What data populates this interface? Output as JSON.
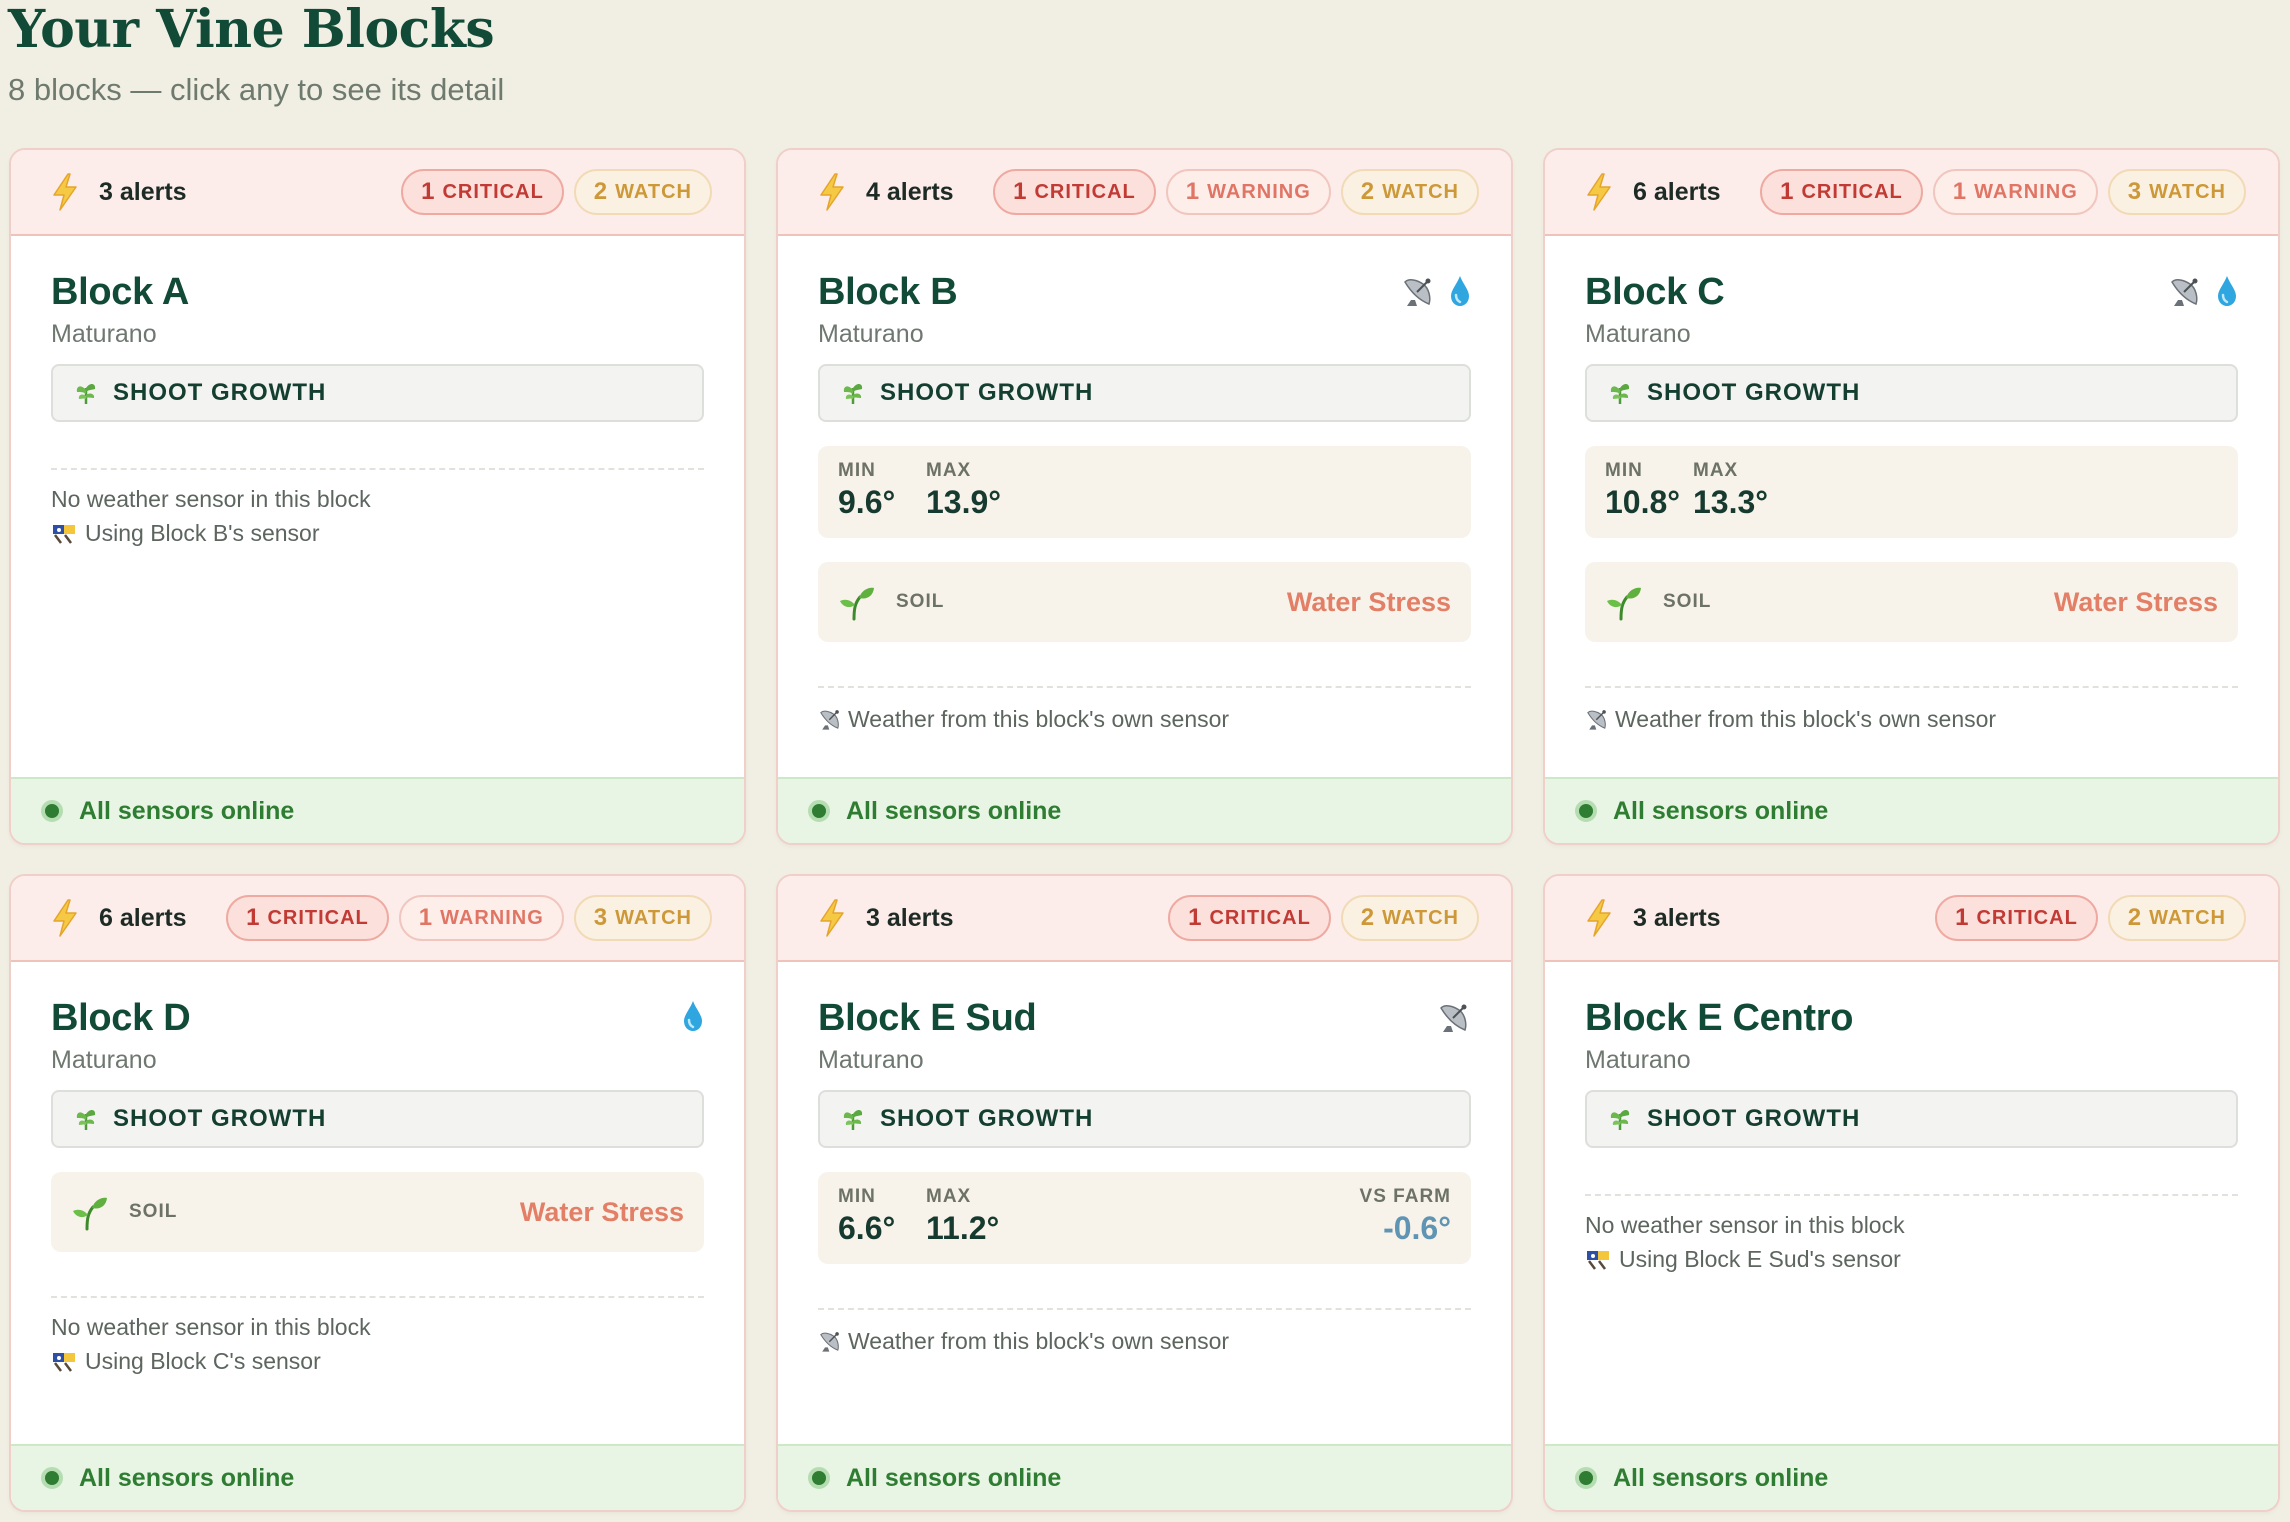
{
  "header": {
    "title": "Your Vine Blocks",
    "subtitle": "8 blocks — click any to see its detail"
  },
  "colors": {
    "background": "#f1efe3",
    "title": "#114a36",
    "critical": "#c23a34",
    "warning": "#e07565",
    "watch": "#cd9838",
    "online": "#2e7d32",
    "water_stress": "#e27f66",
    "vs_farm": "#5f94b3"
  },
  "labels": {
    "critical": "CRITICAL",
    "warning": "WARNING",
    "watch": "WATCH",
    "min": "MIN",
    "max": "MAX",
    "vs_farm": "VS FARM",
    "soil": "SOIL",
    "no_sensor": "No weather sensor in this block",
    "own_sensor": "Weather from this block's own sensor",
    "online": "All sensors online"
  },
  "blocks": [
    {
      "alerts": "3 alerts",
      "critical": "1",
      "warning": null,
      "watch": "2",
      "name": "Block A",
      "variety": "Maturano",
      "stage": "SHOOT GROWTH",
      "icons": [],
      "temp": null,
      "soil": null,
      "sensor_note": "Using Block B's sensor"
    },
    {
      "alerts": "4 alerts",
      "critical": "1",
      "warning": "1",
      "watch": "2",
      "name": "Block B",
      "variety": "Maturano",
      "stage": "SHOOT GROWTH",
      "icons": [
        "satellite-icon",
        "water-drop-icon"
      ],
      "temp": {
        "min": "9.6°",
        "max": "13.9°",
        "vs_farm": null
      },
      "soil": "Water Stress",
      "sensor_note": null
    },
    {
      "alerts": "6 alerts",
      "critical": "1",
      "warning": "1",
      "watch": "3",
      "name": "Block C",
      "variety": "Maturano",
      "stage": "SHOOT GROWTH",
      "icons": [
        "satellite-icon",
        "water-drop-icon"
      ],
      "temp": {
        "min": "10.8°",
        "max": "13.3°",
        "vs_farm": null
      },
      "soil": "Water Stress",
      "sensor_note": null
    },
    {
      "alerts": "6 alerts",
      "critical": "1",
      "warning": "1",
      "watch": "3",
      "name": "Block D",
      "variety": "Maturano",
      "stage": "SHOOT GROWTH",
      "icons": [
        "water-drop-icon"
      ],
      "temp": null,
      "soil": "Water Stress",
      "sensor_note": "Using Block C's sensor"
    },
    {
      "alerts": "3 alerts",
      "critical": "1",
      "warning": null,
      "watch": "2",
      "name": "Block E Sud",
      "variety": "Maturano",
      "stage": "SHOOT GROWTH",
      "icons": [
        "satellite-icon"
      ],
      "temp": {
        "min": "6.6°",
        "max": "11.2°",
        "vs_farm": "-0.6°"
      },
      "soil": null,
      "sensor_note": null
    },
    {
      "alerts": "3 alerts",
      "critical": "1",
      "warning": null,
      "watch": "2",
      "name": "Block E Centro",
      "variety": "Maturano",
      "stage": "SHOOT GROWTH",
      "icons": [],
      "temp": null,
      "soil": null,
      "sensor_note": "Using Block E Sud's sensor"
    }
  ]
}
